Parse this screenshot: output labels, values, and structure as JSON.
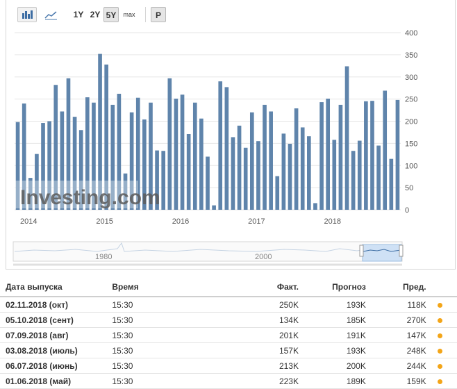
{
  "toolbar": {
    "bar_chart_icon": "bar-chart-icon",
    "line_chart_icon": "line-chart-icon",
    "ranges": [
      "1Y",
      "2Y",
      "5Y",
      "max"
    ],
    "selected_range": "5Y",
    "p_button": "P"
  },
  "colors": {
    "bar": "#5f84ab",
    "positive": "#2a9d2a",
    "negative": "#e0251e",
    "dot": "#f3a518"
  },
  "watermark": "Investing.com",
  "navigator": {
    "labels": [
      "1980",
      "2000"
    ]
  },
  "chart_data": {
    "type": "bar",
    "x_tick_labels": [
      "2014",
      "2015",
      "2016",
      "2017",
      "2018"
    ],
    "y_ticks": [
      0,
      50,
      100,
      150,
      200,
      250,
      300,
      350,
      400
    ],
    "ylim": [
      0,
      400
    ],
    "values": [
      198,
      240,
      72,
      126,
      196,
      200,
      282,
      222,
      297,
      210,
      180,
      254,
      242,
      352,
      328,
      237,
      262,
      82,
      220,
      253,
      204,
      242,
      134,
      133,
      297,
      251,
      260,
      171,
      242,
      206,
      120,
      10,
      290,
      277,
      164,
      190,
      140,
      220,
      155,
      237,
      222,
      76,
      172,
      149,
      229,
      186,
      166,
      15,
      243,
      251,
      158,
      237,
      324,
      133,
      156,
      245,
      246,
      145,
      269,
      115,
      248
    ]
  },
  "table": {
    "headers": [
      "Дата выпуска",
      "Время",
      "Факт.",
      "Прогноз",
      "Пред."
    ],
    "rows": [
      {
        "date": "02.11.2018 (окт)",
        "time": "15:30",
        "actual": "250K",
        "actual_dir": "pos",
        "forecast": "193K",
        "prev": "118K",
        "prev_dir": "neg"
      },
      {
        "date": "05.10.2018 (сент)",
        "time": "15:30",
        "actual": "134K",
        "actual_dir": "neg",
        "forecast": "185K",
        "prev": "270K",
        "prev_dir": "pos"
      },
      {
        "date": "07.09.2018 (авг)",
        "time": "15:30",
        "actual": "201K",
        "actual_dir": "pos",
        "forecast": "191K",
        "prev": "147K",
        "prev_dir": "neg"
      },
      {
        "date": "03.08.2018 (июль)",
        "time": "15:30",
        "actual": "157K",
        "actual_dir": "neg",
        "forecast": "193K",
        "prev": "248K",
        "prev_dir": "pos"
      },
      {
        "date": "06.07.2018 (июнь)",
        "time": "15:30",
        "actual": "213K",
        "actual_dir": "pos",
        "forecast": "200K",
        "prev": "244K",
        "prev_dir": "pos"
      },
      {
        "date": "01.06.2018 (май)",
        "time": "15:30",
        "actual": "223K",
        "actual_dir": "pos",
        "forecast": "189K",
        "prev": "159K",
        "prev_dir": "neg"
      }
    ]
  }
}
